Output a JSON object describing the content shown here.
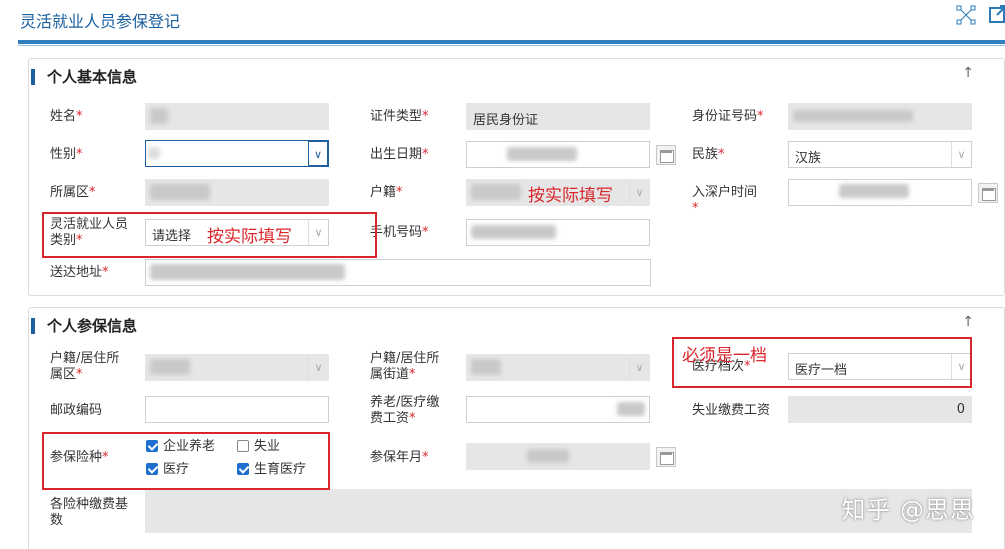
{
  "header": {
    "title": "灵活就业人员参保登记"
  },
  "section1": {
    "title": "个人基本信息",
    "labels": {
      "name": "姓名",
      "id_type": "证件类型",
      "id_number": "身份证号码",
      "gender": "性别",
      "birth_date": "出生日期",
      "ethnicity": "民族",
      "district": "所属区",
      "household": "户籍",
      "hukou_time": "入深户时间",
      "worker_category_l1": "灵活就业人员",
      "worker_category_l2": "类别",
      "phone": "手机号码",
      "address": "送达地址"
    },
    "values": {
      "id_type": "居民身份证",
      "ethnicity": "汉族",
      "worker_category": "请选择"
    }
  },
  "section2": {
    "title": "个人参保信息",
    "labels": {
      "reg_district_l1": "户籍/居住所",
      "reg_district_l2": "属区",
      "reg_street_l1": "户籍/居住所",
      "reg_street_l2": "属街道",
      "medical_level": "医疗档次",
      "postcode": "邮政编码",
      "pension_wage_l1": "养老/医疗缴",
      "pension_wage_l2": "费工资",
      "unemployment_wage": "失业缴费工资",
      "insurance_types": "参保险种",
      "insured_month": "参保年月",
      "base_l1": "各险种缴费基",
      "base_l2": "数"
    },
    "values": {
      "medical_level": "医疗一档",
      "unemployment_wage": "0"
    },
    "checkboxes": [
      {
        "label": "企业养老",
        "checked": true
      },
      {
        "label": "失业",
        "checked": false
      },
      {
        "label": "医疗",
        "checked": true
      },
      {
        "label": "生育医疗",
        "checked": true
      }
    ]
  },
  "annotations": {
    "fill_actual_1": "按实际填写",
    "fill_actual_2": "按实际填写",
    "must_level1": "必须是一档"
  },
  "watermark": "知乎 @思思",
  "required_mark": "*",
  "colors": {
    "accent": "#1d5f9f",
    "annotation": "#d9262c",
    "checkbox": "#1e6fd0"
  }
}
